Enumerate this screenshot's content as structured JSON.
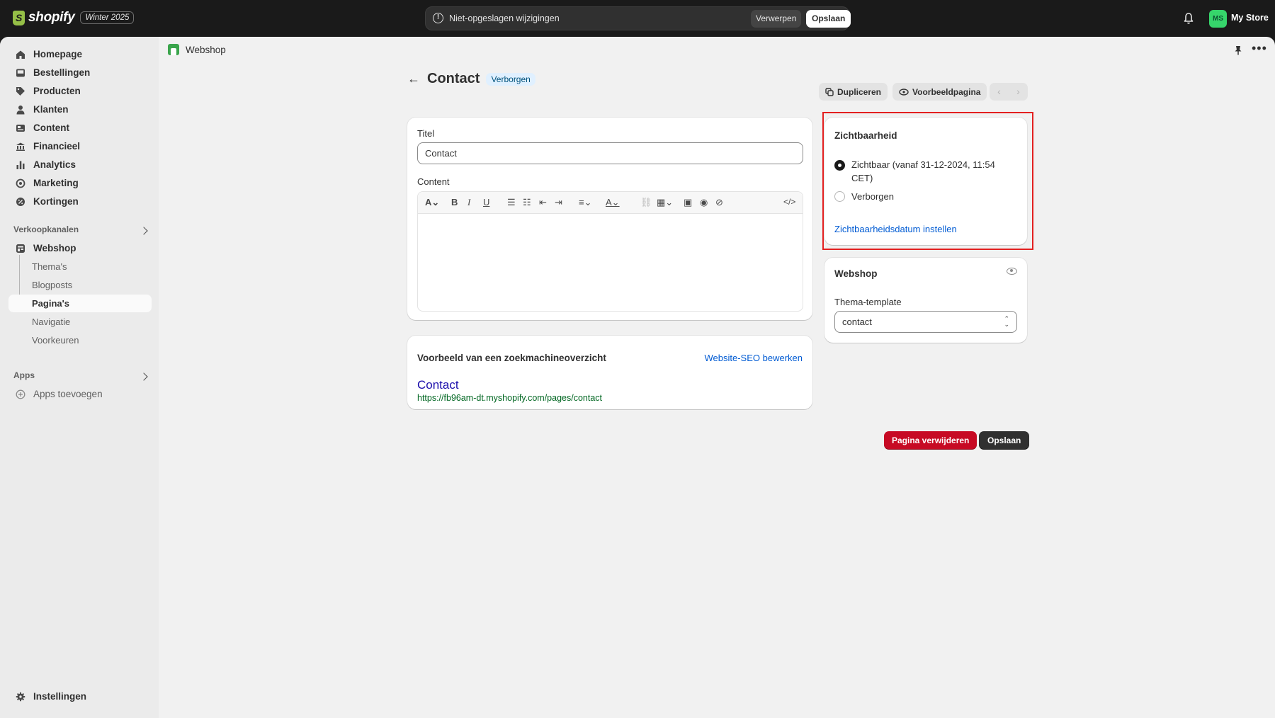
{
  "topbar": {
    "brand": "shopify",
    "edition": "Winter 2025",
    "unsaved_text": "Niet-opgeslagen wijzigingen",
    "discard_label": "Verwerpen",
    "save_label": "Opslaan",
    "avatar_initials": "MS",
    "store_name": "My Store"
  },
  "sidebar": {
    "items": [
      {
        "label": "Homepage",
        "icon": "home-icon"
      },
      {
        "label": "Bestellingen",
        "icon": "inbox-icon"
      },
      {
        "label": "Producten",
        "icon": "tag-icon"
      },
      {
        "label": "Klanten",
        "icon": "person-icon"
      },
      {
        "label": "Content",
        "icon": "content-icon"
      },
      {
        "label": "Financieel",
        "icon": "bank-icon"
      },
      {
        "label": "Analytics",
        "icon": "chart-bar-icon"
      },
      {
        "label": "Marketing",
        "icon": "target-icon"
      },
      {
        "label": "Kortingen",
        "icon": "discount-icon"
      }
    ],
    "sales_channels_title": "Verkoopkanalen",
    "webshop_label": "Webshop",
    "webshop_subitems": [
      "Thema's",
      "Blogposts",
      "Pagina's",
      "Navigatie",
      "Voorkeuren"
    ],
    "apps_title": "Apps",
    "add_apps_label": "Apps toevoegen",
    "settings_label": "Instellingen"
  },
  "breadcrumb": {
    "label": "Webshop"
  },
  "page": {
    "title": "Contact",
    "status_badge": "Verborgen",
    "duplicate_label": "Dupliceren",
    "preview_label": "Voorbeeldpagina"
  },
  "content_card": {
    "title_label": "Titel",
    "title_value": "Contact",
    "content_label": "Content"
  },
  "seo_card": {
    "heading": "Voorbeeld van een zoekmachineoverzicht",
    "edit_link": "Website-SEO bewerken",
    "page_title": "Contact",
    "url": "https://fb96am-dt.myshopify.com/pages/contact"
  },
  "visibility_card": {
    "heading": "Zichtbaarheid",
    "option_visible": "Zichtbaar (vanaf 31-12-2024, 11:54 CET)",
    "option_hidden": "Verborgen",
    "selected": "visible",
    "set_date_link": "Zichtbaarheidsdatum instellen"
  },
  "webshop_card": {
    "heading": "Webshop",
    "template_label": "Thema-template",
    "template_value": "contact"
  },
  "actions": {
    "delete_label": "Pagina verwijderen",
    "save_label": "Opslaan"
  },
  "colors": {
    "delete": "#c70a24",
    "highlight": "#e32020",
    "link": "#005bd3",
    "avatar": "#36d56b"
  }
}
